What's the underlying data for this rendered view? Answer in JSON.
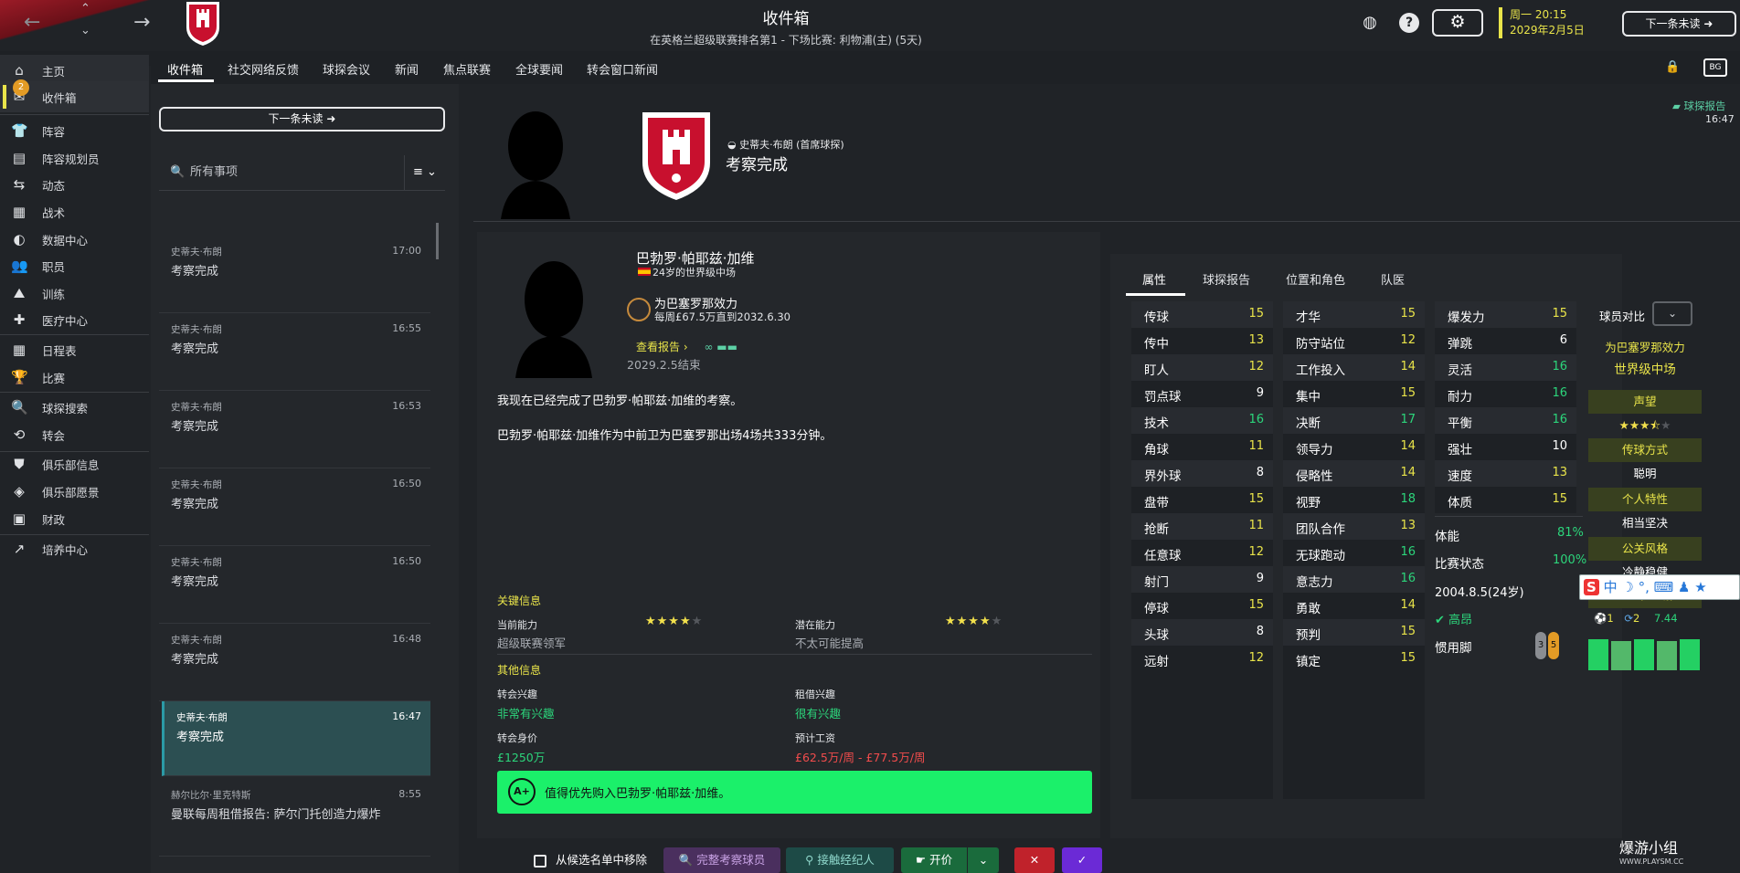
{
  "topbar": {
    "title": "收件箱",
    "subtitle": "在英格兰超级联赛排名第1 - 下场比赛: 利物浦(主) (5天)",
    "date_line1": "周一 20:15",
    "date_line2": "2029年2月5日",
    "next_unread": "下一条未读",
    "help_icon": "?",
    "settings_icon": "⚙"
  },
  "sidebar": {
    "items": [
      {
        "label": "主页",
        "icon": "home-icon"
      },
      {
        "label": "收件箱",
        "icon": "inbox-icon",
        "badge": "2"
      },
      {
        "label": "阵容",
        "icon": "shirt-icon"
      },
      {
        "label": "阵容规划员",
        "icon": "clipboard-icon"
      },
      {
        "label": "动态",
        "icon": "dynamics-icon"
      },
      {
        "label": "战术",
        "icon": "tactics-icon"
      },
      {
        "label": "数据中心",
        "icon": "data-icon"
      },
      {
        "label": "职员",
        "icon": "staff-icon"
      },
      {
        "label": "训练",
        "icon": "training-icon"
      },
      {
        "label": "医疗中心",
        "icon": "medical-icon"
      },
      {
        "label": "日程表",
        "icon": "calendar-icon"
      },
      {
        "label": "比赛",
        "icon": "trophy-icon"
      },
      {
        "label": "球探搜索",
        "icon": "search-icon"
      },
      {
        "label": "转会",
        "icon": "transfer-icon"
      },
      {
        "label": "俱乐部信息",
        "icon": "shield-icon"
      },
      {
        "label": "俱乐部愿景",
        "icon": "vision-icon"
      },
      {
        "label": "财政",
        "icon": "finance-icon"
      },
      {
        "label": "培养中心",
        "icon": "development-icon"
      }
    ]
  },
  "tabs": [
    "收件箱",
    "社交网络反馈",
    "球探会议",
    "新闻",
    "焦点联赛",
    "全球要闻",
    "转会窗口新闻"
  ],
  "inbox": {
    "next_unread": "下一条未读",
    "search_placeholder": "所有事项",
    "messages": [
      {
        "from": "史蒂夫·布朗",
        "time": "17:00",
        "subject": "考察完成"
      },
      {
        "from": "史蒂夫·布朗",
        "time": "16:55",
        "subject": "考察完成"
      },
      {
        "from": "史蒂夫·布朗",
        "time": "16:53",
        "subject": "考察完成"
      },
      {
        "from": "史蒂夫·布朗",
        "time": "16:50",
        "subject": "考察完成"
      },
      {
        "from": "史蒂夫·布朗",
        "time": "16:50",
        "subject": "考察完成"
      },
      {
        "from": "史蒂夫·布朗",
        "time": "16:48",
        "subject": "考察完成"
      },
      {
        "from": "史蒂夫·布朗",
        "time": "16:47",
        "subject": "考察完成"
      },
      {
        "from": "赫尔比尔·里克特斯",
        "time": "8:55",
        "subject": "曼联每周租借报告: 萨尔门托创造力爆炸"
      }
    ]
  },
  "message": {
    "sender": "史蒂夫·布朗 (首席球探)",
    "title": "考察完成",
    "scout_report_label": "球探报告",
    "time": "16:47",
    "player_name": "巴勃罗·帕耶兹·加维",
    "player_age": "24岁的世界级中场",
    "club_line": "为巴塞罗那效力",
    "contract_line": "每周£67.5万直到2032.6.30",
    "view_report": "查看报告 ›",
    "scout_ended": "2029.2.5结束",
    "body1": "我现在已经完成了巴勃罗·帕耶兹·加维的考察。",
    "body2": "巴勃罗·帕耶兹·加维作为中前卫为巴塞罗那出场4场共333分钟。",
    "key_info": "关键信息",
    "current_ability_label": "当前能力",
    "current_ability_value": "超级联赛领军",
    "current_ability_stars": 4,
    "potential_ability_label": "潜在能力",
    "potential_ability_value": "不太可能提高",
    "potential_ability_stars": 4,
    "other_info": "其他信息",
    "transfer_interest_label": "转会兴趣",
    "transfer_interest_value": "非常有兴趣",
    "loan_interest_label": "租借兴趣",
    "loan_interest_value": "很有兴趣",
    "value_label": "转会身价",
    "value_value": "£1250万",
    "wage_label": "预计工资",
    "wage_value": "£62.5万/周 - £77.5万/周",
    "rec_grade": "A+",
    "recommendation": "值得优先购入巴勃罗·帕耶兹·加维。"
  },
  "attr_tabs": [
    "属性",
    "球探报告",
    "位置和角色",
    "队医"
  ],
  "attributes": {
    "col1": [
      [
        "传球",
        "15",
        "y"
      ],
      [
        "传中",
        "13",
        "y"
      ],
      [
        "盯人",
        "12",
        "y"
      ],
      [
        "罚点球",
        "9",
        "w"
      ],
      [
        "技术",
        "16",
        "g"
      ],
      [
        "角球",
        "11",
        "y"
      ],
      [
        "界外球",
        "8",
        "w"
      ],
      [
        "盘带",
        "15",
        "y"
      ],
      [
        "抢断",
        "11",
        "y"
      ],
      [
        "任意球",
        "12",
        "y"
      ],
      [
        "射门",
        "9",
        "w"
      ],
      [
        "停球",
        "15",
        "y"
      ],
      [
        "头球",
        "8",
        "w"
      ],
      [
        "远射",
        "12",
        "y"
      ]
    ],
    "col2": [
      [
        "才华",
        "15",
        "y"
      ],
      [
        "防守站位",
        "12",
        "y"
      ],
      [
        "工作投入",
        "14",
        "y"
      ],
      [
        "集中",
        "15",
        "y"
      ],
      [
        "决断",
        "17",
        "g"
      ],
      [
        "领导力",
        "14",
        "y"
      ],
      [
        "侵略性",
        "14",
        "y"
      ],
      [
        "视野",
        "18",
        "g"
      ],
      [
        "团队合作",
        "13",
        "y"
      ],
      [
        "无球跑动",
        "16",
        "g"
      ],
      [
        "意志力",
        "16",
        "g"
      ],
      [
        "勇敢",
        "14",
        "y"
      ],
      [
        "预判",
        "15",
        "y"
      ],
      [
        "镇定",
        "15",
        "y"
      ]
    ],
    "col3": [
      [
        "爆发力",
        "15",
        "y"
      ],
      [
        "弹跳",
        "6",
        "w"
      ],
      [
        "灵活",
        "16",
        "g"
      ],
      [
        "耐力",
        "16",
        "g"
      ],
      [
        "平衡",
        "16",
        "g"
      ],
      [
        "强壮",
        "10",
        "w"
      ],
      [
        "速度",
        "13",
        "y"
      ],
      [
        "体质",
        "15",
        "y"
      ]
    ],
    "fitness_label": "体能",
    "fitness_value": "81%",
    "match_label": "比赛状态",
    "match_value": "100%",
    "dob": "2004.8.5(24岁)",
    "height": "高昂",
    "foot_label": "惯用脚",
    "foot_left": "3",
    "foot_right": "5"
  },
  "compare": {
    "header": "球员对比",
    "club": "为巴塞罗那效力",
    "level": "世界级中场",
    "reputation_label": "声望",
    "reputation_stars": 3.5,
    "passing_style_label": "传球方式",
    "passing_style_value": "聪明",
    "personality_label": "个人特性",
    "personality_value": "相当坚决",
    "media_label": "公关风格",
    "media_value": "冷静稳健",
    "form_label": "状态 (近5场)",
    "goals": "1",
    "assists": "2",
    "avg_rating": "7.44",
    "form_bars": [
      0.9,
      0.85,
      0.9,
      0.85,
      0.9
    ]
  },
  "bottombar": {
    "remove_label": "从候选名单中移除",
    "full_scout_label": "完整考察球员",
    "contact_agent_label": "接触经纪人",
    "offer_label": "开价",
    "reject_symbol": "✕",
    "accept_symbol": "✓"
  },
  "ime_text": "中 ☽ °, ⌨ ♟ ★",
  "watermark": "爆游小组",
  "watermark_sub": "WWW.PLAYSM.CC",
  "colors": {
    "accent": "#e9e44a",
    "green": "#2cd57b",
    "red": "#f24c4c",
    "club_red": "#c8102e",
    "teal_sel": "#2c4f52"
  }
}
